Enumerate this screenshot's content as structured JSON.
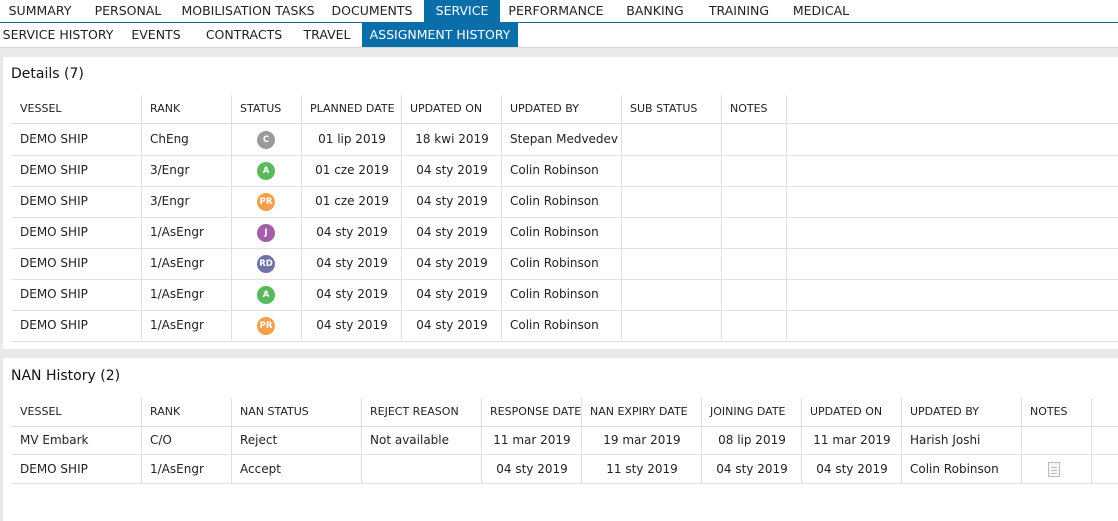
{
  "tabs_main": [
    {
      "label": "SUMMARY",
      "active": false
    },
    {
      "label": "PERSONAL",
      "active": false
    },
    {
      "label": "MOBILISATION TASKS",
      "active": false
    },
    {
      "label": "DOCUMENTS",
      "active": false
    },
    {
      "label": "SERVICE",
      "active": true
    },
    {
      "label": "PERFORMANCE",
      "active": false
    },
    {
      "label": "BANKING",
      "active": false
    },
    {
      "label": "TRAINING",
      "active": false
    },
    {
      "label": "MEDICAL",
      "active": false
    }
  ],
  "tabs_sub": [
    {
      "label": "SERVICE HISTORY",
      "active": false
    },
    {
      "label": "EVENTS",
      "active": false
    },
    {
      "label": "CONTRACTS",
      "active": false
    },
    {
      "label": "TRAVEL",
      "active": false
    },
    {
      "label": "ASSIGNMENT HISTORY",
      "active": true
    }
  ],
  "details": {
    "title": "Details (7)",
    "columns": [
      "VESSEL",
      "RANK",
      "STATUS",
      "PLANNED DATE",
      "UPDATED ON",
      "UPDATED BY",
      "SUB STATUS",
      "NOTES"
    ],
    "rows": [
      {
        "vessel": "DEMO SHIP",
        "rank": "ChEng",
        "status": "C",
        "status_color": "#9a9a9a",
        "planned_date": "01 lip 2019",
        "updated_on": "18 kwi 2019",
        "updated_by": "Stepan Medvedev",
        "sub_status": "",
        "notes": ""
      },
      {
        "vessel": "DEMO SHIP",
        "rank": "3/Engr",
        "status": "A",
        "status_color": "#5cb85c",
        "planned_date": "01 cze 2019",
        "updated_on": "04 sty 2019",
        "updated_by": "Colin Robinson",
        "sub_status": "",
        "notes": ""
      },
      {
        "vessel": "DEMO SHIP",
        "rank": "3/Engr",
        "status": "PR",
        "status_color": "#f6a04d",
        "planned_date": "01 cze 2019",
        "updated_on": "04 sty 2019",
        "updated_by": "Colin Robinson",
        "sub_status": "",
        "notes": ""
      },
      {
        "vessel": "DEMO SHIP",
        "rank": "1/AsEngr",
        "status": "J",
        "status_color": "#a55ea8",
        "planned_date": "04 sty 2019",
        "updated_on": "04 sty 2019",
        "updated_by": "Colin Robinson",
        "sub_status": "",
        "notes": ""
      },
      {
        "vessel": "DEMO SHIP",
        "rank": "1/AsEngr",
        "status": "RD",
        "status_color": "#6f73a6",
        "planned_date": "04 sty 2019",
        "updated_on": "04 sty 2019",
        "updated_by": "Colin Robinson",
        "sub_status": "",
        "notes": ""
      },
      {
        "vessel": "DEMO SHIP",
        "rank": "1/AsEngr",
        "status": "A",
        "status_color": "#5cb85c",
        "planned_date": "04 sty 2019",
        "updated_on": "04 sty 2019",
        "updated_by": "Colin Robinson",
        "sub_status": "",
        "notes": ""
      },
      {
        "vessel": "DEMO SHIP",
        "rank": "1/AsEngr",
        "status": "PR",
        "status_color": "#f6a04d",
        "planned_date": "04 sty 2019",
        "updated_on": "04 sty 2019",
        "updated_by": "Colin Robinson",
        "sub_status": "",
        "notes": ""
      }
    ]
  },
  "nan_history": {
    "title": "NAN History (2)",
    "columns": [
      "VESSEL",
      "RANK",
      "NAN STATUS",
      "REJECT REASON",
      "RESPONSE DATE",
      "NAN EXPIRY DATE",
      "JOINING DATE",
      "UPDATED ON",
      "UPDATED BY",
      "NOTES"
    ],
    "rows": [
      {
        "vessel": "MV Embark",
        "rank": "C/O",
        "nan_status": "Reject",
        "reject_reason": "Not available",
        "response_date": "11 mar 2019",
        "nan_expiry_date": "19 mar 2019",
        "joining_date": "08 lip 2019",
        "updated_on": "11 mar 2019",
        "updated_by": "Harish Joshi",
        "notes_icon": ""
      },
      {
        "vessel": "DEMO SHIP",
        "rank": "1/AsEngr",
        "nan_status": "Accept",
        "reject_reason": "",
        "response_date": "04 sty 2019",
        "nan_expiry_date": "11 sty 2019",
        "joining_date": "04 sty 2019",
        "updated_on": "04 sty 2019",
        "updated_by": "Colin Robinson",
        "notes_icon": "document-icon"
      }
    ]
  },
  "colors": {
    "accent": "#0a6ea8"
  }
}
